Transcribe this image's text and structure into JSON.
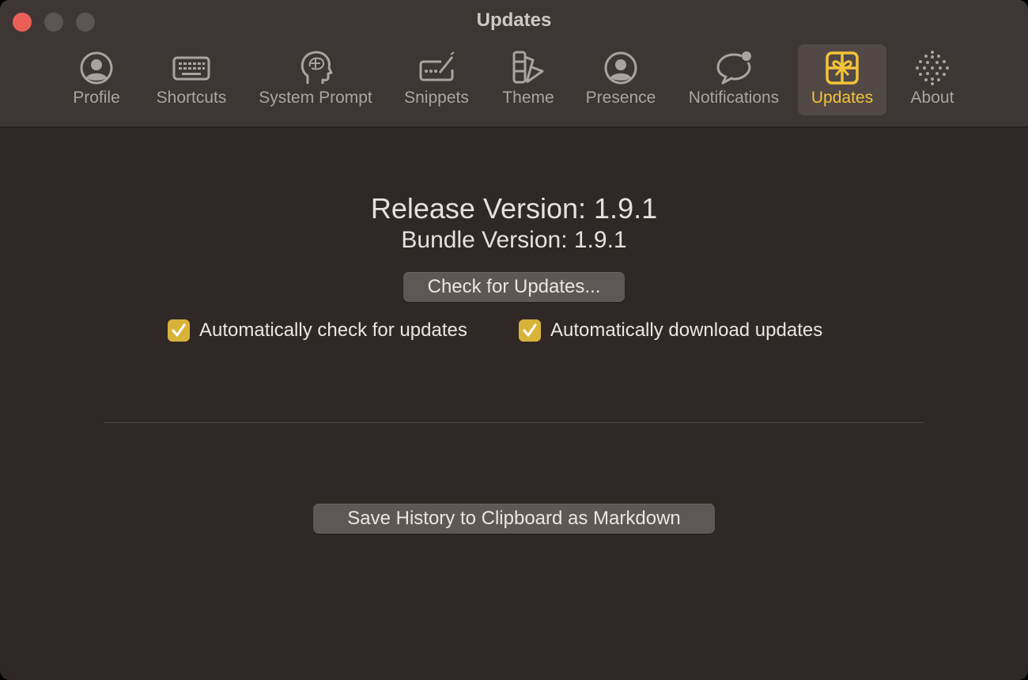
{
  "window": {
    "title": "Updates"
  },
  "toolbar": {
    "items": [
      {
        "label": "Profile",
        "icon": "person-circle-icon"
      },
      {
        "label": "Shortcuts",
        "icon": "keyboard-icon"
      },
      {
        "label": "System Prompt",
        "icon": "brain-head-icon"
      },
      {
        "label": "Snippets",
        "icon": "text-cursor-box-icon"
      },
      {
        "label": "Theme",
        "icon": "swatch-palette-icon"
      },
      {
        "label": "Presence",
        "icon": "person-circle-icon"
      },
      {
        "label": "Notifications",
        "icon": "speech-bubble-badge-icon"
      },
      {
        "label": "Updates",
        "icon": "gift-box-icon",
        "active": true
      },
      {
        "label": "About",
        "icon": "dotted-sphere-icon"
      }
    ],
    "active_color": "#f2c338"
  },
  "updates": {
    "release_version": "Release Version: 1.9.1",
    "bundle_version": "Bundle Version: 1.9.1",
    "check_button": "Check for Updates...",
    "auto_check": {
      "label": "Automatically check for updates",
      "checked": true
    },
    "auto_download": {
      "label": "Automatically download updates",
      "checked": true
    },
    "save_history_button": "Save History to Clipboard as Markdown"
  }
}
